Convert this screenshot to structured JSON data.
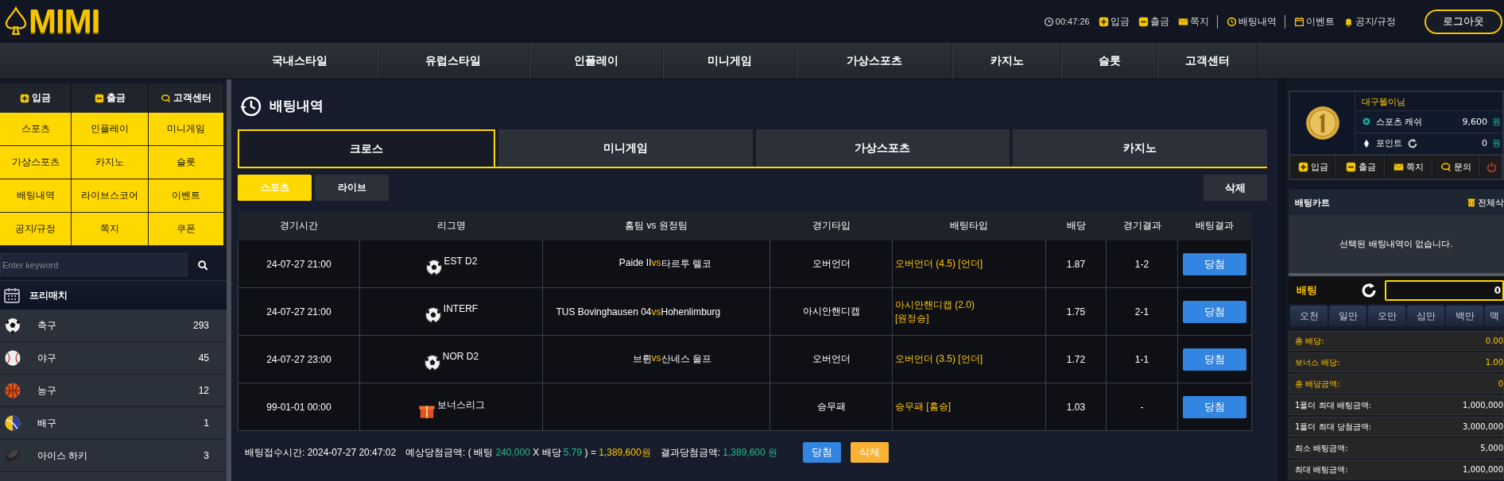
{
  "header": {
    "logo": "MIMI",
    "time": "00:47:26",
    "links": [
      {
        "label": "입금",
        "kind": "plus",
        "divider": false
      },
      {
        "label": "출금",
        "kind": "minus",
        "divider": false
      },
      {
        "label": "쪽지",
        "kind": "mail",
        "divider": true
      },
      {
        "label": "배팅내역",
        "kind": "history",
        "divider": true
      },
      {
        "label": "이벤트",
        "kind": "calendar",
        "divider": false
      },
      {
        "label": "공지/규정",
        "kind": "bell",
        "divider": false
      }
    ],
    "logout": "로그아웃"
  },
  "nav": [
    {
      "label": "국내스타일"
    },
    {
      "label": "유럽스타일"
    },
    {
      "label": "인플레이"
    },
    {
      "label": "미니게임"
    },
    {
      "label": "가상스포츠"
    },
    {
      "label": "카지노"
    },
    {
      "label": "슬롯"
    },
    {
      "label": "고객센터"
    }
  ],
  "sidebar": {
    "quick": [
      {
        "label": "입금",
        "kind": "plus"
      },
      {
        "label": "출금",
        "kind": "minus"
      },
      {
        "label": "고객센터",
        "kind": "chat"
      }
    ],
    "menu": [
      "스포츠",
      "인플레이",
      "미니게임",
      "가상스포츠",
      "카지노",
      "슬롯",
      "배팅내역",
      "라이브스코어",
      "이벤트",
      "공지/규정",
      "쪽지",
      "쿠폰"
    ],
    "search": {
      "placeholder": "Enter keyword"
    },
    "prematch": "프리매치",
    "sports": [
      {
        "name": "축구",
        "count": "293",
        "kind": "soccer"
      },
      {
        "name": "야구",
        "count": "45",
        "kind": "baseball"
      },
      {
        "name": "농구",
        "count": "12",
        "kind": "basketball"
      },
      {
        "name": "배구",
        "count": "1",
        "kind": "volleyball"
      },
      {
        "name": "아이스 하키",
        "count": "3",
        "kind": "puck"
      }
    ]
  },
  "main": {
    "title": "배팅내역",
    "tabs": [
      {
        "label": "크로스",
        "selected": true
      },
      {
        "label": "미니게임",
        "selected": false
      },
      {
        "label": "가상스포츠",
        "selected": false
      },
      {
        "label": "카지노",
        "selected": false
      }
    ],
    "subtabs": [
      {
        "label": "스포츠",
        "selected": true
      },
      {
        "label": "라이브",
        "selected": false
      }
    ],
    "delete": "삭제",
    "table": {
      "columns": [
        "경기시간",
        "리그명",
        "홈팀 vs 원정팀",
        "경기타입",
        "배팅타입",
        "배당",
        "경기결과",
        "배팅결과"
      ],
      "rows": [
        {
          "time": "24-07-27 21:00",
          "league": {
            "name": "EST D2",
            "kind": "soccer"
          },
          "home": "Paide II",
          "vs": "vs",
          "away": "타르투 렐코",
          "type": "오버언더",
          "bet": "오버언더 (4.5) [언더]",
          "odds": "1.87",
          "score": "1-2",
          "outcome": "당첨"
        },
        {
          "time": "24-07-27 21:00",
          "league": {
            "name": "INTERF",
            "kind": "soccer"
          },
          "home": "TUS Bovinghausen 04",
          "vs": "vs",
          "away": "Hohenlimburg",
          "type": "아시안핸디캡",
          "bet": "아시안핸디캡 (2.0) [원정승]",
          "odds": "1.75",
          "score": "2-1",
          "outcome": "당첨"
        },
        {
          "time": "24-07-27 23:00",
          "league": {
            "name": "NOR D2",
            "kind": "soccer"
          },
          "home": "브륀",
          "vs": "vs",
          "away": "산네스 울프",
          "type": "오버언더",
          "bet": "오버언더 (3.5) [언더]",
          "odds": "1.72",
          "score": "1-1",
          "outcome": "당첨"
        },
        {
          "time": "99-01-01 00:00",
          "league": {
            "name": "보너스리그",
            "kind": "gift"
          },
          "type": "승무패",
          "bet": "승무패 [홈승]",
          "odds": "1.03",
          "score": "-",
          "outcome": "당첨"
        }
      ]
    },
    "summary": {
      "received": "배팅접수시간: 2024-07-27 20:47:02",
      "expected": [
        {
          "text": "예상당첨금액: ( 배팅 ",
          "kind": "plain"
        },
        {
          "text": "240,000",
          "kind": "green"
        },
        {
          "text": " X 배당 ",
          "kind": "plain"
        },
        {
          "text": "5.79",
          "kind": "green"
        },
        {
          "text": " ) = ",
          "kind": "plain"
        },
        {
          "text": "1,389,600원",
          "kind": "gold"
        }
      ],
      "result": [
        {
          "text": "결과당첨금액: ",
          "kind": "plain"
        },
        {
          "text": "1,389,600 원",
          "kind": "green"
        }
      ],
      "win_button": "당첨",
      "delete_button": "삭제"
    }
  },
  "account": {
    "user": "대구똘이님",
    "balances": [
      {
        "label": "스포츠 캐쉬",
        "value": "9,600",
        "unit": "원",
        "kind": "ball",
        "refresh": false
      },
      {
        "label": "포인트",
        "value": "0",
        "unit": "원",
        "kind": "diamond",
        "refresh": true
      }
    ],
    "actions": [
      {
        "label": "입금",
        "kind": "plus"
      },
      {
        "label": "출금",
        "kind": "minus"
      },
      {
        "label": "쪽지",
        "kind": "mail"
      },
      {
        "label": "문의",
        "kind": "chat"
      },
      {
        "kind": "power"
      }
    ]
  },
  "betslip": {
    "title": "배팅카트",
    "clear": "전체삭",
    "empty": "선택된 배팅내역이 없습니다.",
    "bet_label": "배팅",
    "amount": "0",
    "chips": [
      "오천",
      "일만",
      "오만",
      "십만",
      "백만",
      "맥"
    ],
    "stats": [
      {
        "label": "총 배당:",
        "value": "0.00",
        "highlight": true
      },
      {
        "label": "보너스 배당:",
        "value": "1.00",
        "highlight": true
      },
      {
        "label": "총 배당금액:",
        "value": "0",
        "highlight": true
      },
      {
        "label": "1폴더 최대 배팅금액:",
        "value": "1,000,000",
        "highlight": false
      },
      {
        "label": "1폴더 최대 당첨금액:",
        "value": "3,000,000",
        "highlight": false
      },
      {
        "label": "최소 배팅금액:",
        "value": "5,000",
        "highlight": false
      },
      {
        "label": "최대 배팅금액:",
        "value": "1,000,000",
        "highlight": false
      }
    ]
  }
}
